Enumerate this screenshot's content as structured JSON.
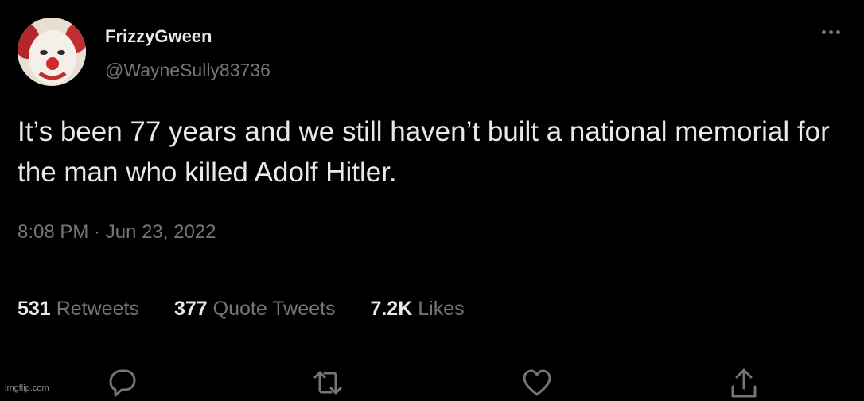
{
  "tweet": {
    "author": {
      "display_name": "FrizzyGween",
      "handle": "@WayneSully83736",
      "avatar_icon": "clown-face-avatar"
    },
    "text": "It’s been 77 years and we still haven’t built a national memorial for the man who killed Adolf Hitler.",
    "timestamp": "8:08 PM · Jun 23, 2022",
    "stats": {
      "retweets_count": "531",
      "retweets_label": "Retweets",
      "quote_tweets_count": "377",
      "quote_tweets_label": "Quote Tweets",
      "likes_count": "7.2K",
      "likes_label": "Likes"
    },
    "actions": [
      "reply-icon",
      "retweet-icon",
      "like-icon",
      "share-icon"
    ]
  },
  "watermark": "imgflip.com",
  "colors": {
    "background": "#000000",
    "text_primary": "#e7e9ea",
    "text_secondary": "#71767b",
    "divider": "#2f3336"
  }
}
